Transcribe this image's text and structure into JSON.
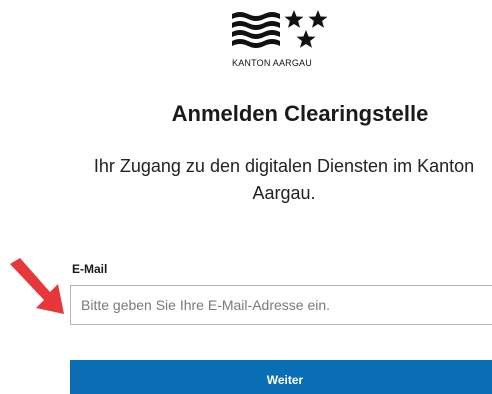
{
  "brand": {
    "logo_text": "KANTON AARGAU",
    "logo_color": "#111111"
  },
  "heading": {
    "title": "Anmelden Clearingstelle",
    "subtitle": "Ihr Zugang zu den digitalen Diensten im Kanton Aargau."
  },
  "form": {
    "email_label": "E-Mail",
    "email_value": "",
    "email_placeholder": "Bitte geben Sie Ihre E-Mail-Adresse ein.",
    "submit_label": "Weiter",
    "submit_color": "#0a6eb4"
  },
  "annotation": {
    "arrow_icon": "red-arrow-icon",
    "arrow_color": "#e8373a"
  }
}
